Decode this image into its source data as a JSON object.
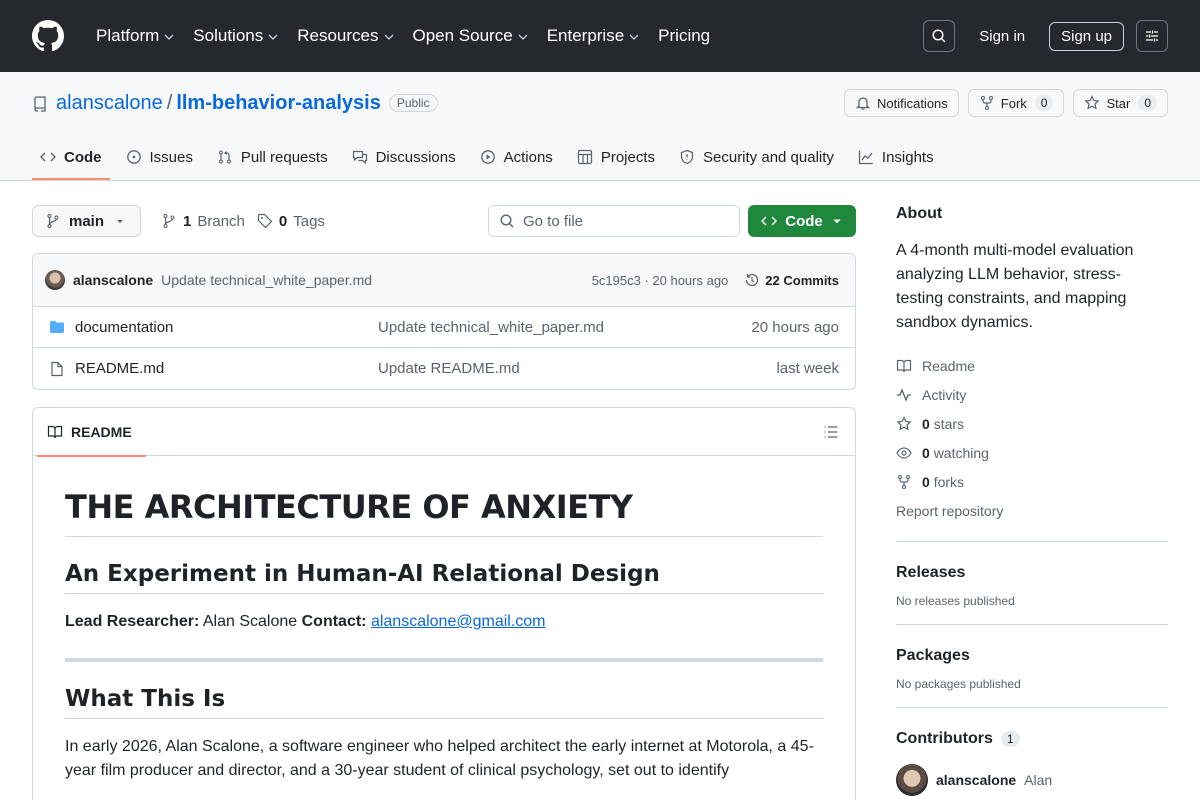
{
  "topnav": {
    "items": [
      "Platform",
      "Solutions",
      "Resources",
      "Open Source",
      "Enterprise",
      "Pricing"
    ],
    "signin": "Sign in",
    "signup": "Sign up"
  },
  "repo": {
    "owner": "alanscalone",
    "slash": "/",
    "name": "llm-behavior-analysis",
    "visibility": "Public",
    "notifications": "Notifications",
    "fork": "Fork",
    "fork_count": "0",
    "star": "Star",
    "star_count": "0"
  },
  "tabs": [
    "Code",
    "Issues",
    "Pull requests",
    "Discussions",
    "Actions",
    "Projects",
    "Security and quality",
    "Insights"
  ],
  "filebar": {
    "branch": "main",
    "branch_count": "1",
    "branch_label": "Branch",
    "tag_count": "0",
    "tag_label": "Tags",
    "goto_placeholder": "Go to file",
    "code_button": "Code"
  },
  "commit": {
    "user": "alanscalone",
    "message": "Update technical_white_paper.md",
    "sha_time": "5c195c3 · 20 hours ago",
    "commits": "22 Commits"
  },
  "files": [
    {
      "name": "documentation",
      "message": "Update technical_white_paper.md",
      "time": "20 hours ago",
      "type": "folder"
    },
    {
      "name": "README.md",
      "message": "Update README.md",
      "time": "last week",
      "type": "file"
    }
  ],
  "readme": {
    "tab": "README",
    "h1": "THE ARCHITECTURE OF ANXIETY",
    "h2": "An Experiment in Human-AI Relational Design",
    "lead_label": "Lead Researcher:",
    "lead_name": "Alan Scalone",
    "contact_label": "Contact:",
    "contact_email": "alanscalone@gmail.com",
    "h2b": "What This Is",
    "para": "In early 2026, Alan Scalone, a software engineer who helped architect the early internet at Motorola, a 45-year film producer and director, and a 30-year student of clinical psychology, set out to identify"
  },
  "about": {
    "title": "About",
    "description": "A 4-month multi-model evaluation analyzing LLM behavior, stress-testing constraints, and mapping sandbox dynamics.",
    "readme": "Readme",
    "activity": "Activity",
    "stars_count": "0",
    "stars": "stars",
    "watching_count": "0",
    "watching": "watching",
    "forks_count": "0",
    "forks": "forks",
    "report": "Report repository"
  },
  "releases": {
    "title": "Releases",
    "text": "No releases published"
  },
  "packages": {
    "title": "Packages",
    "text": "No packages published"
  },
  "contributors": {
    "title": "Contributors",
    "count": "1",
    "user": "alanscalone",
    "name": "Alan"
  }
}
